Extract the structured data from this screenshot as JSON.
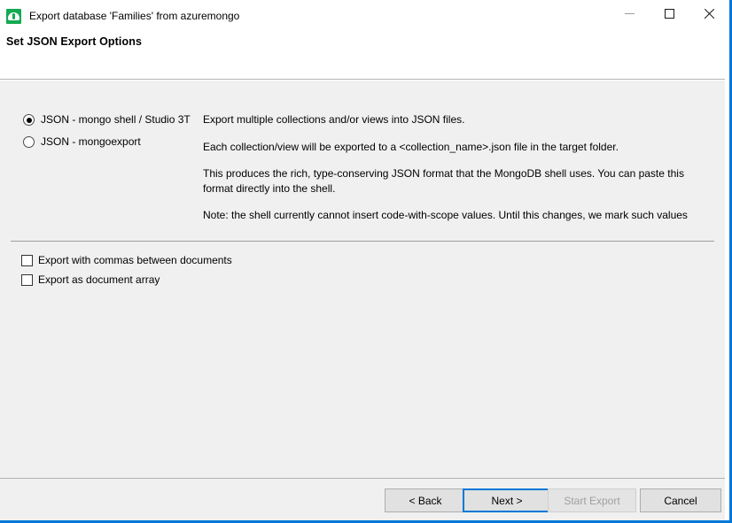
{
  "window": {
    "title": "Export database 'Families' from azuremongo",
    "icon": "studio3t-leaf-icon",
    "accent_color": "#0078d7",
    "controls": {
      "minimize": "minimize-icon",
      "maximize": "maximize-icon",
      "close": "close-icon"
    }
  },
  "page": {
    "heading": "Set JSON Export Options"
  },
  "format_options": {
    "selected": "JSON - mongo shell / Studio 3T",
    "items": [
      {
        "label": "JSON - mongo shell / Studio 3T",
        "checked": true
      },
      {
        "label": "JSON - mongoexport",
        "checked": false
      }
    ]
  },
  "description": {
    "paragraphs": [
      "Export multiple collections and/or views into JSON files.",
      "Each collection/view will be exported to a <collection_name>.json file in the target folder.",
      "This produces the rich, type-conserving JSON format that the MongoDB shell uses. You can paste this format directly into the shell.",
      "Note: the shell currently cannot insert code-with-scope values. Until this changes, we mark such values"
    ]
  },
  "checkboxes": [
    {
      "label": "Export with commas between documents",
      "checked": false
    },
    {
      "label": "Export as document array",
      "checked": false
    }
  ],
  "buttons": {
    "back": "< Back",
    "next": "Next >",
    "start_export": "Start Export",
    "cancel": "Cancel",
    "start_export_enabled": false,
    "next_focused": true
  }
}
